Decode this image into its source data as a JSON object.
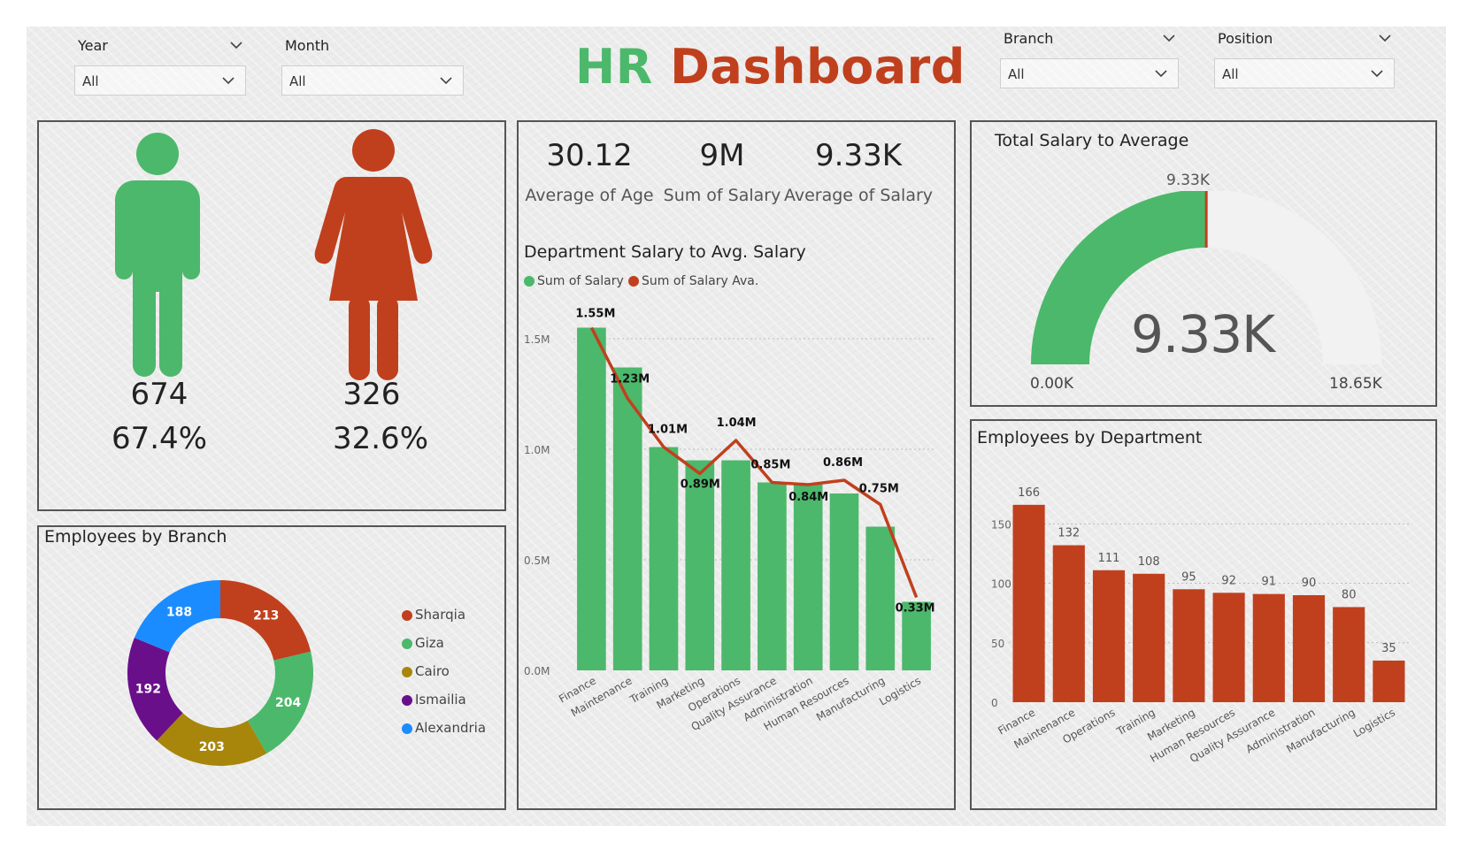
{
  "header": {
    "title_hr": "HR",
    "title_dash": "Dashboard",
    "hr_color": "#4cb86b",
    "dash_color": "#c0401e"
  },
  "filters": {
    "year": {
      "label": "Year",
      "value": "All"
    },
    "month": {
      "label": "Month",
      "value": "All"
    },
    "branch": {
      "label": "Branch",
      "value": "All"
    },
    "position": {
      "label": "Position",
      "value": "All"
    }
  },
  "gender": {
    "male": {
      "count": "674",
      "pct": "67.4%",
      "color": "#4cb86b",
      "icon": "male-person-icon"
    },
    "female": {
      "count": "326",
      "pct": "32.6%",
      "color": "#c0401e",
      "icon": "female-person-icon"
    }
  },
  "kpis": [
    {
      "value": "30.12",
      "label": "Average of Age"
    },
    {
      "value": "9M",
      "label": "Sum of Salary"
    },
    {
      "value": "9.33K",
      "label": "Average of Salary"
    }
  ],
  "gauge_panel": {
    "title": "Total Salary to Average",
    "target_label": "9.33K",
    "value_label": "9.33K",
    "min_label": "0.00K",
    "max_label": "18.65K"
  },
  "branch_panel": {
    "title": "Employees by Branch"
  },
  "dept_salary_panel": {
    "title": "Department Salary to Avg. Salary"
  },
  "dept_emp_panel": {
    "title": "Employees by Department"
  },
  "chart_data": [
    {
      "type": "bar",
      "id": "dept-salary",
      "title": "Department Salary to Avg. Salary",
      "categories": [
        "Finance",
        "Maintenance",
        "Training",
        "Marketing",
        "Operations",
        "Quality Assurance",
        "Administration",
        "Human Resources",
        "Manufacturing",
        "Logistics"
      ],
      "series": [
        {
          "name": "Sum of Salary",
          "kind": "bar",
          "color": "#4cb86b",
          "values": [
            1.55,
            1.37,
            1.01,
            0.95,
            0.95,
            0.85,
            0.84,
            0.8,
            0.65,
            0.31
          ]
        },
        {
          "name": "Sum of Salary Ava.",
          "kind": "line",
          "color": "#c0401e",
          "values": [
            1.55,
            1.23,
            1.01,
            0.89,
            1.04,
            0.85,
            0.84,
            0.86,
            0.75,
            0.33
          ],
          "labels": [
            "1.55M",
            "1.23M",
            "1.01M",
            "0.89M",
            "1.04M",
            "0.85M",
            "0.84M",
            "0.86M",
            "0.75M",
            "0.33M"
          ]
        }
      ],
      "yticks": [
        "0.0M",
        "0.5M",
        "1.0M",
        "1.5M"
      ],
      "ylim": [
        0,
        1.6
      ],
      "unit": "M",
      "grid": true,
      "legend": "top-left"
    },
    {
      "type": "bar",
      "id": "dept-employees",
      "title": "Employees by Department",
      "categories": [
        "Finance",
        "Maintenance",
        "Operations",
        "Training",
        "Marketing",
        "Human Resources",
        "Quality Assurance",
        "Administration",
        "Manufacturing",
        "Logistics"
      ],
      "values": [
        166,
        132,
        111,
        108,
        95,
        92,
        91,
        90,
        80,
        35
      ],
      "color": "#c0401e",
      "yticks": [
        "0",
        "50",
        "100",
        "150"
      ],
      "ylim": [
        0,
        180
      ],
      "grid": true
    },
    {
      "type": "pie",
      "id": "branch-donut",
      "title": "Employees by Branch",
      "slices": [
        {
          "name": "Sharqia",
          "value": 213,
          "color": "#c0401e"
        },
        {
          "name": "Giza",
          "value": 204,
          "color": "#4cb86b"
        },
        {
          "name": "Cairo",
          "value": 203,
          "color": "#a8860b"
        },
        {
          "name": "Ismailia",
          "value": 192,
          "color": "#6a0f8a"
        },
        {
          "name": "Alexandria",
          "value": 188,
          "color": "#1a8cff"
        }
      ],
      "legend": "right"
    },
    {
      "type": "gauge",
      "id": "salary-gauge",
      "title": "Total Salary to Average",
      "value": 9.33,
      "min": 0,
      "max": 18.65,
      "target": 9.33,
      "unit": "K",
      "fill_color": "#4cb86b",
      "track_color": "#f2f2f2",
      "target_color": "#c0401e"
    }
  ]
}
